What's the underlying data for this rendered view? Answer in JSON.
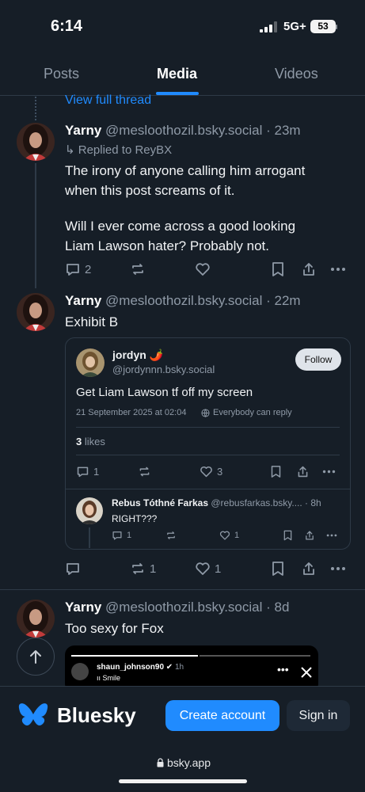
{
  "status": {
    "time": "6:14",
    "network": "5G+",
    "battery": "53"
  },
  "tabs": {
    "posts": "Posts",
    "media": "Media",
    "videos": "Videos"
  },
  "thread": {
    "view_full": "View full thread"
  },
  "post1": {
    "name": "Yarny",
    "handle": "@mesloothozil.bsky.social · 23m",
    "reply_to": "↳ Replied to ReyBX",
    "text_line1": "The irony of anyone calling him arrogant",
    "text_line2": "when this post screams of it.",
    "text_line3": "Will I ever come across a good looking",
    "text_line4": "Liam Lawson hater? Probably not.",
    "reply_count": "2"
  },
  "post2": {
    "name": "Yarny",
    "handle": "@mesloothozil.bsky.social · 22m",
    "text": "Exhibit B",
    "repost_count": "1",
    "like_count": "1"
  },
  "quote": {
    "name": "jordyn 🌶️",
    "handle": "@jordynnn.bsky.social",
    "follow": "Follow",
    "text": "Get Liam Lawson tf off my screen",
    "date": "21 September 2025 at 02:04",
    "audience": "Everybody can reply",
    "likes_num": "3",
    "likes_label": " likes",
    "reply_count": "1",
    "like_count": "3",
    "reply": {
      "name": "Rebus Tóthné Farkas",
      "handle": "@rebusfarkas.bsky.... · 8h",
      "text": "RIGHT???",
      "reply_count": "1",
      "like_count": "1"
    }
  },
  "post3": {
    "name": "Yarny",
    "handle": "@mesloothozil.bsky.social · 8d",
    "text": "Too sexy for Fox",
    "embed_user": "shaun_johnson90",
    "embed_time": "1h",
    "embed_sub": "Smile"
  },
  "footer": {
    "brand": "Bluesky",
    "create": "Create account",
    "signin": "Sign in"
  },
  "browser": {
    "url": "bsky.app"
  },
  "colors": {
    "accent": "#208bfe",
    "background": "#161e27",
    "border": "#2e3a47",
    "muted": "#8f9aa7"
  }
}
